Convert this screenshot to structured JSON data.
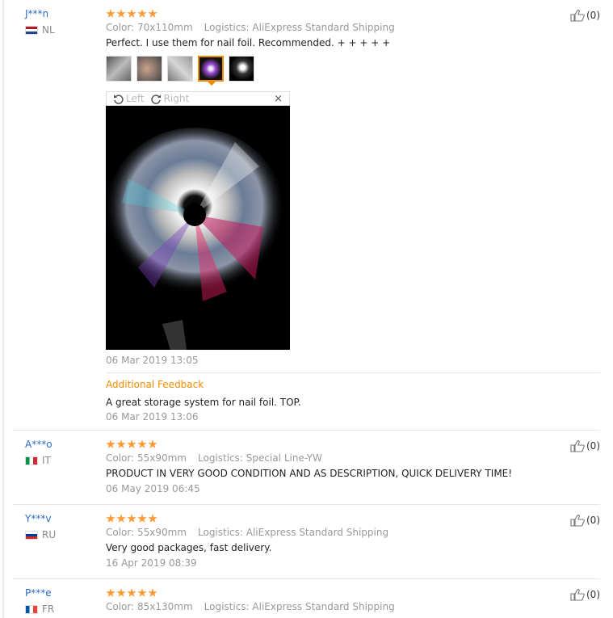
{
  "reviews": [
    {
      "user": "J***n",
      "country": "NL",
      "stars": 5,
      "color": "Color: 70x110mm",
      "logistics": "Logistics: AliExpress Standard Shipping",
      "text": "Perfect. I use them for nail foil. Recommended. + + + + +",
      "date": "06 Mar 2019 13:05",
      "helpful": "(0)",
      "viewer": {
        "left": "Left",
        "right": "Right",
        "close": "×"
      },
      "additional": {
        "label": "Additional Feedback",
        "text": "A great storage system for nail foil. TOP.",
        "date": "06 Mar 2019 13:06"
      }
    },
    {
      "user": "A***o",
      "country": "IT",
      "stars": 5,
      "color": "Color: 55x90mm",
      "logistics": "Logistics: Special Line-YW",
      "text": "PRODUCT IN VERY GOOD CONDITION AND AS DESCRIPTION, QUICK DELIVERY TIME!",
      "date": "06 May 2019 06:45",
      "helpful": "(0)"
    },
    {
      "user": "Y***v",
      "country": "RU",
      "stars": 5,
      "color": "Color: 55x90mm",
      "logistics": "Logistics: AliExpress Standard Shipping",
      "text": "Very good packages, fast delivery.",
      "date": "16 Apr 2019 08:39",
      "helpful": "(0)"
    },
    {
      "user": "P***e",
      "country": "FR",
      "stars": 5,
      "color": "Color: 85x130mm",
      "logistics": "Logistics: AliExpress Standard Shipping",
      "helpful": "(0)"
    }
  ]
}
